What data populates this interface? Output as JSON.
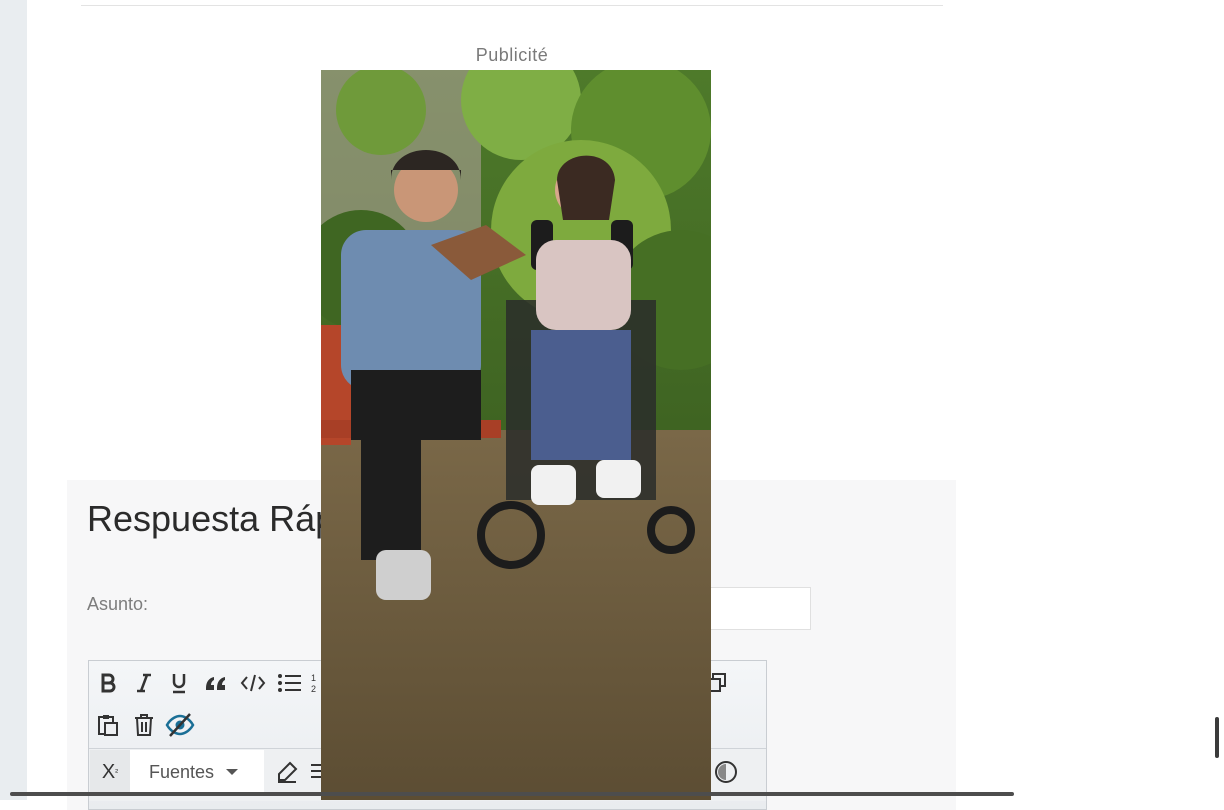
{
  "ad": {
    "label": "Publicité"
  },
  "quick_reply": {
    "title": "Respuesta Rápida",
    "subject_label": "Asunto:",
    "subject_value": ""
  },
  "editor": {
    "toolbar_row1": [
      "bold-icon",
      "italic-icon",
      "underline-icon",
      "quote-icon",
      "code-icon",
      "bullet-list-icon",
      "numbered-list-icon"
    ],
    "toolbar_row2": [
      "paste-icon",
      "delete-icon",
      "hide-icon"
    ],
    "fonts_label": "Fuentes",
    "superscript_label": "X"
  }
}
